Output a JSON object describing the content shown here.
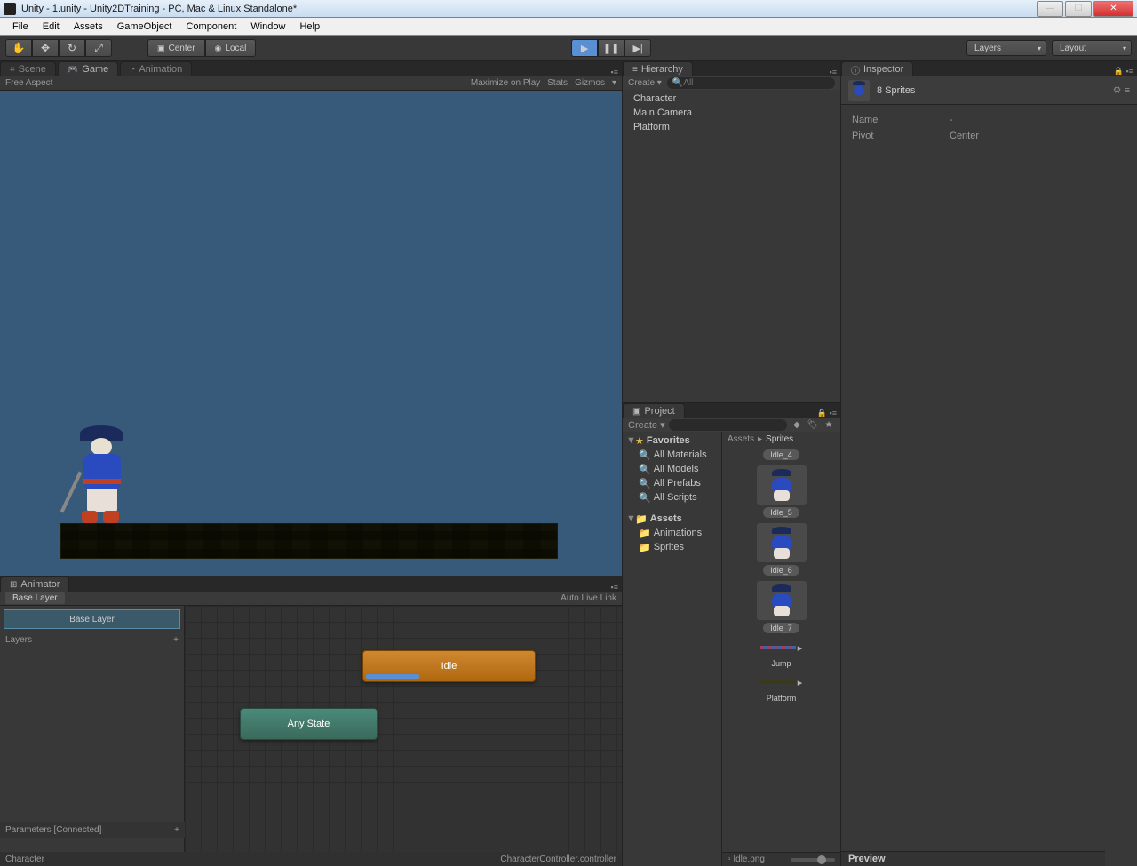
{
  "titlebar": {
    "title": "Unity - 1.unity - Unity2DTraining - PC, Mac & Linux Standalone*"
  },
  "menubar": [
    "File",
    "Edit",
    "Assets",
    "GameObject",
    "Component",
    "Window",
    "Help"
  ],
  "toolbar": {
    "pivot_center": "Center",
    "pivot_local": "Local",
    "layers": "Layers",
    "layout": "Layout"
  },
  "tabs": {
    "scene": "Scene",
    "game": "Game",
    "animation": "Animation",
    "animator": "Animator",
    "hierarchy": "Hierarchy",
    "project": "Project",
    "inspector": "Inspector"
  },
  "game_bar": {
    "aspect": "Free Aspect",
    "maximize": "Maximize on Play",
    "stats": "Stats",
    "gizmos": "Gizmos"
  },
  "hierarchy": {
    "create": "Create",
    "search_placeholder": "All",
    "items": [
      "Character",
      "Main Camera",
      "Platform"
    ]
  },
  "project": {
    "create": "Create",
    "breadcrumb": [
      "Assets",
      "Sprites"
    ],
    "favorites_label": "Favorites",
    "favorites": [
      "All Materials",
      "All Models",
      "All Prefabs",
      "All Scripts"
    ],
    "assets_label": "Assets",
    "folders": [
      "Animations",
      "Sprites"
    ],
    "sprites": [
      "Idle_4",
      "Idle_5",
      "Idle_6",
      "Idle_7",
      "Jump",
      "Platform"
    ],
    "footer": "Idle.png"
  },
  "inspector": {
    "title": "8 Sprites",
    "rows": [
      {
        "k": "Name",
        "v": "-"
      },
      {
        "k": "Pivot",
        "v": "Center"
      }
    ],
    "preview": "Preview"
  },
  "animator": {
    "breadcrumb": "Base Layer",
    "auto_link": "Auto Live Link",
    "base_layer": "Base Layer",
    "layers": "Layers",
    "parameters": "Parameters [Connected]",
    "states": {
      "idle": "Idle",
      "any": "Any State"
    },
    "status_left": "Character",
    "status_right": "CharacterController.controller"
  }
}
